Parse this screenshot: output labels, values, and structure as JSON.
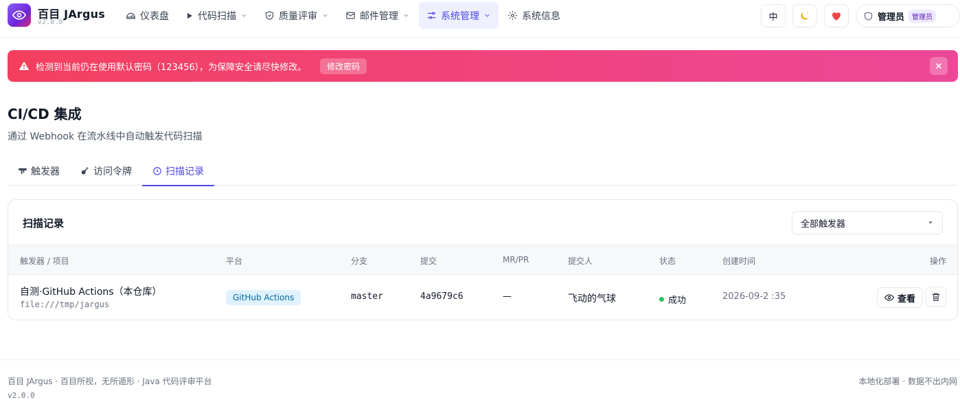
{
  "brand": {
    "name": "百目 JArgus",
    "version": "v2.0.0"
  },
  "nav": [
    {
      "label": "仪表盘",
      "icon": "gauge-icon",
      "dropdown": false,
      "active": false
    },
    {
      "label": "代码扫描",
      "icon": "play-icon",
      "dropdown": true,
      "active": false
    },
    {
      "label": "质量评审",
      "icon": "shield-icon",
      "dropdown": true,
      "active": false
    },
    {
      "label": "邮件管理",
      "icon": "mail-icon",
      "dropdown": true,
      "active": false
    },
    {
      "label": "系统管理",
      "icon": "sliders-icon",
      "dropdown": true,
      "active": true
    },
    {
      "label": "系统信息",
      "icon": "gear-icon",
      "dropdown": false,
      "active": false
    }
  ],
  "header_right": {
    "lang_label": "中",
    "theme_icon": "moon-icon",
    "favorite_icon": "heart-icon",
    "user_name": "管理员",
    "user_role": "管理员"
  },
  "alert": {
    "text": "检测到当前仍在使用默认密码（123456），为保障安全请尽快修改。",
    "action_label": "修改密码"
  },
  "page": {
    "title": "CI/CD 集成",
    "subtitle": "通过 Webhook 在流水线中自动触发代码扫描"
  },
  "tabs": [
    {
      "label": "触发器",
      "icon": "trigger-icon",
      "active": false
    },
    {
      "label": "访问令牌",
      "icon": "key-icon",
      "active": false
    },
    {
      "label": "扫描记录",
      "icon": "clock-icon",
      "active": true
    }
  ],
  "card": {
    "title": "扫描记录",
    "filter_value": "全部触发器"
  },
  "table": {
    "columns": [
      "触发器 / 项目",
      "平台",
      "分支",
      "提交",
      "MR/PR",
      "提交人",
      "状态",
      "创建时间",
      "操作"
    ],
    "rows": [
      {
        "trigger": "自测·GitHub Actions（本仓库）",
        "project": "file:///tmp/jargus",
        "platform": "GitHub Actions",
        "branch": "master",
        "commit": "4a9679c6",
        "mr": "—",
        "author": "飞动的气球",
        "status": "成功",
        "created": "2026-09-2   :35",
        "view_label": "查看"
      }
    ]
  },
  "footer": {
    "left": "百目 JArgus · 百目所视，无所遁形 · Java 代码评审平台",
    "version": "v2.0.0",
    "right": "本地化部署 · 数据不出内网"
  },
  "colors": {
    "accent": "#4f46e5",
    "alert_start": "#f43f5e",
    "alert_end": "#ec4899",
    "success": "#22c55e"
  }
}
